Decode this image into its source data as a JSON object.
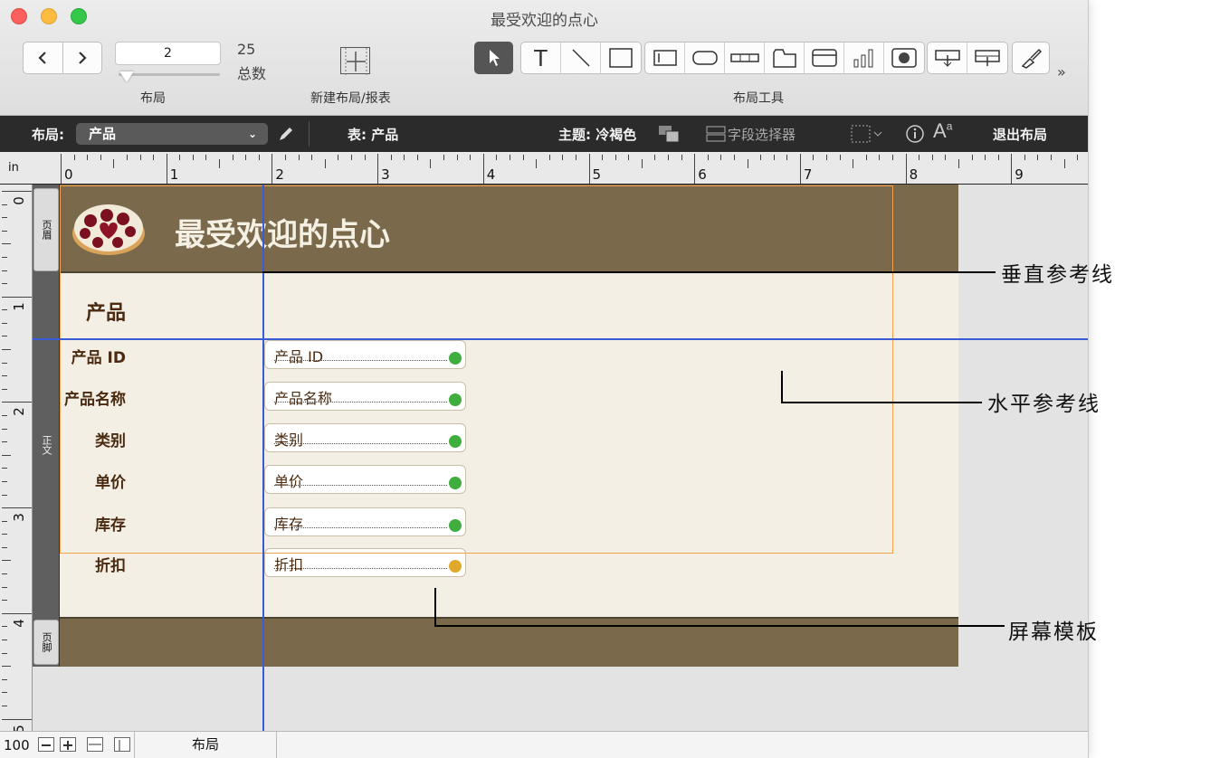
{
  "window": {
    "title": "最受欢迎的点心"
  },
  "toolbar": {
    "page_value": "2",
    "total_count": "25",
    "total_label": "总数",
    "layout_label": "布局",
    "new_layout_label": "新建布局/报表",
    "tools_label": "布局工具",
    "more_chevron": "»"
  },
  "layout_bar": {
    "layout_prefix": "布局:",
    "layout_selected": "产品",
    "table_label": "表: 产品",
    "theme_label": "主题: 冷褐色",
    "field_picker_label": "字段选择器",
    "exit_label": "退出布局"
  },
  "ruler": {
    "unit": "in",
    "top_numbers": [
      "0",
      "1",
      "2",
      "3",
      "4",
      "5",
      "6",
      "7",
      "8",
      "9"
    ],
    "left_numbers": [
      "0",
      "1",
      "2",
      "3",
      "4",
      "5"
    ]
  },
  "parts": {
    "header_tab": "页眉",
    "body_tab": "正文",
    "footer_tab": "页脚"
  },
  "layout": {
    "header_title": "最受欢迎的点心",
    "subtitle": "产品",
    "fields": [
      {
        "label": "产品 ID",
        "value": "产品 ID",
        "icon_color": "#3fae3f"
      },
      {
        "label": "产品名称",
        "value": "产品名称",
        "icon_color": "#3fae3f"
      },
      {
        "label": "类别",
        "value": "类别",
        "icon_color": "#3fae3f"
      },
      {
        "label": "单价",
        "value": "单价",
        "icon_color": "#3fae3f"
      },
      {
        "label": "库存",
        "value": "库存",
        "icon_color": "#3fae3f"
      },
      {
        "label": "折扣",
        "value": "折扣",
        "icon_color": "#e0a92a"
      }
    ]
  },
  "callouts": {
    "vertical_guide": "垂直参考线",
    "horizontal_guide": "水平参考线",
    "screen_stencil": "屏幕模板"
  },
  "statusbar": {
    "zoom": "100",
    "mode": "布局"
  },
  "colors": {
    "header_brown": "#7a6a4b",
    "body_cream": "#f4efe4",
    "guide_blue": "#3a5bd8",
    "stencil_orange": "#f0a14a",
    "label_brown": "#4a2a10"
  }
}
